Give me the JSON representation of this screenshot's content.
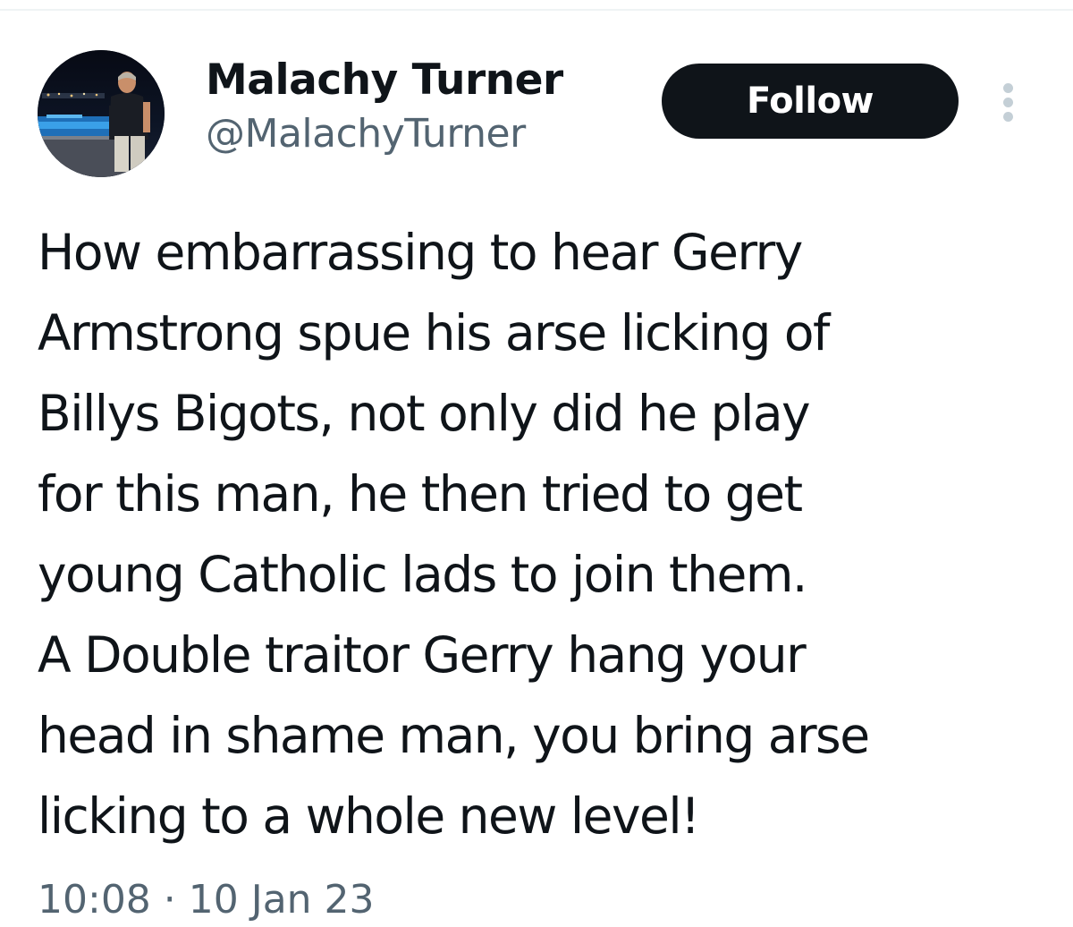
{
  "author": {
    "display_name": "Malachy Turner",
    "handle": "@MalachyTurner"
  },
  "actions": {
    "follow_label": "Follow",
    "more_icon": "more-dots-vertical-icon"
  },
  "tweet": {
    "lines": [
      "How embarrassing to hear Gerry",
      "Armstrong spue his arse licking of",
      "Billys Bigots, not only did he play",
      "for this man, he then tried to get",
      "young Catholic lads to join them.",
      "A Double traitor Gerry hang your",
      "head in shame man, you bring arse",
      "licking to a whole new level!"
    ],
    "timestamp": "10:08 · 10 Jan 23"
  },
  "colors": {
    "text": "#0f1419",
    "secondary_text": "#536471",
    "follow_button_bg": "#0f1419",
    "follow_button_text": "#ffffff",
    "more_dots": "#c4cfd6",
    "divider": "#eff3f4"
  }
}
